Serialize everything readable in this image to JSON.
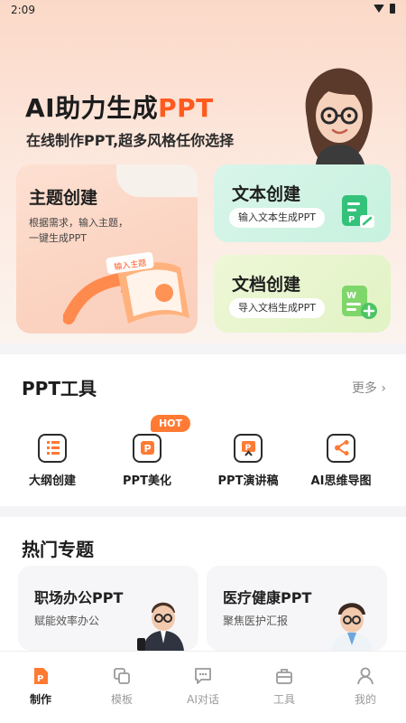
{
  "status": {
    "time": "2:09"
  },
  "hero": {
    "title_prefix": "AI助力生成",
    "title_accent": "PPT",
    "subtitle": "在线制作PPT,超多风格任你选择"
  },
  "cards": {
    "theme": {
      "title": "主题创建",
      "desc": "根据需求，输入主题，一键生成PPT",
      "tag": "输入主题"
    },
    "text": {
      "title": "文本创建",
      "pill": "输入文本生成PPT"
    },
    "doc": {
      "title": "文档创建",
      "pill": "导入文档生成PPT"
    }
  },
  "tools": {
    "title": "PPT工具",
    "more": "更多",
    "hot_badge": "HOT",
    "items": [
      {
        "label": "大纲创建",
        "icon": "outline-icon"
      },
      {
        "label": "PPT美化",
        "icon": "ppt-beautify-icon"
      },
      {
        "label": "PPT演讲稿",
        "icon": "presentation-icon"
      },
      {
        "label": "AI思维导图",
        "icon": "mindmap-icon"
      }
    ]
  },
  "hot_topics": {
    "title": "热门专题",
    "items": [
      {
        "title": "职场办公PPT",
        "subtitle": "赋能效率办公"
      },
      {
        "title": "医疗健康PPT",
        "subtitle": "聚焦医护汇报"
      }
    ]
  },
  "nav": {
    "items": [
      {
        "label": "制作",
        "icon": "make-icon",
        "active": true
      },
      {
        "label": "模板",
        "icon": "template-icon"
      },
      {
        "label": "AI对话",
        "icon": "chat-icon"
      },
      {
        "label": "工具",
        "icon": "toolbox-icon"
      },
      {
        "label": "我的",
        "icon": "profile-icon"
      }
    ]
  },
  "colors": {
    "accent": "#ff5a1f",
    "hot": "#ff7a33",
    "green": "#3dc97c"
  }
}
